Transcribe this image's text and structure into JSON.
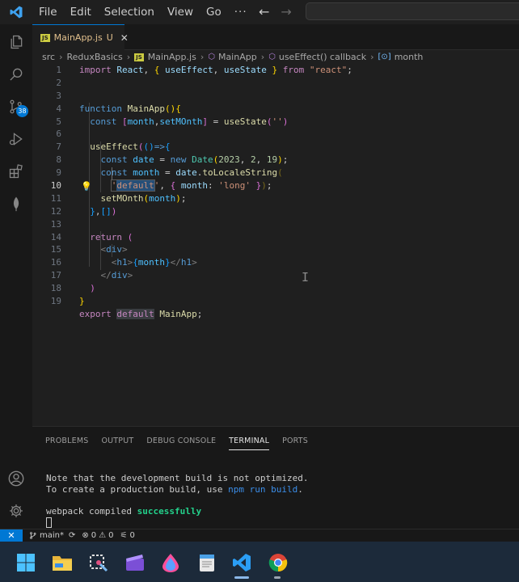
{
  "menu": {
    "file": "File",
    "edit": "Edit",
    "selection": "Selection",
    "view": "View",
    "go": "Go",
    "more": "···"
  },
  "nav": {
    "back": "←",
    "forward": "→"
  },
  "tab": {
    "badge": "JS",
    "name": "MainApp.js",
    "status": "U",
    "close": "✕"
  },
  "breadcrumb": {
    "src": "src",
    "folder": "ReduxBasics",
    "file": "MainApp.js",
    "component": "MainApp",
    "callback": "useEffect() callback",
    "variable": "month"
  },
  "editor": {
    "line_numbers": [
      "1",
      "2",
      "3",
      "4",
      "5",
      "6",
      "7",
      "8",
      "9",
      "10",
      "11",
      "12",
      "13",
      "14",
      "15",
      "16",
      "17",
      "18",
      "19"
    ],
    "active_line": "9"
  },
  "source_control_badge": "38",
  "panel": {
    "tabs": [
      "PROBLEMS",
      "OUTPUT",
      "DEBUG CONSOLE",
      "TERMINAL",
      "PORTS"
    ],
    "active_tab": "TERMINAL",
    "terminal": {
      "line1": "Note that the development build is not optimized.",
      "line2_prefix": "To create a production build, use ",
      "line2_cmd": "npm run build",
      "line2_suffix": ".",
      "line3_prefix": "webpack compiled ",
      "line3_status": "successfully"
    }
  },
  "statusbar": {
    "branch": "main*",
    "errors": "0",
    "warnings": "0",
    "ports": "0"
  },
  "colors": {
    "accent": "#0078d4",
    "editor_bg": "#1f1f1f",
    "modified": "#e2c08d",
    "success": "#23d18b"
  }
}
